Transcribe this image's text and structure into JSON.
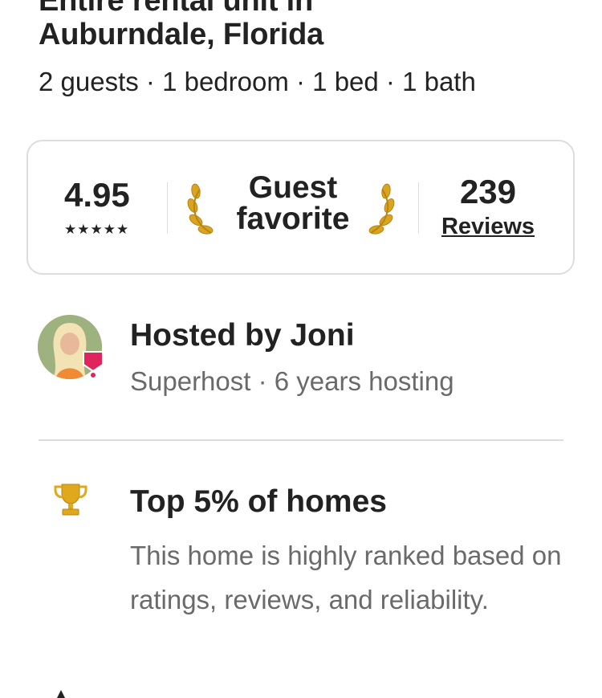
{
  "listing": {
    "title_line_1": "Entire rental unit in",
    "title_line_2": "Auburndale, Florida",
    "details": "2 guests · 1 bedroom · 1 bed · 1 bath"
  },
  "rating_card": {
    "rating": "4.95",
    "stars": "★★★★★",
    "star_count": 5,
    "badge_line_1": "Guest",
    "badge_line_2": "favorite",
    "reviews_count": "239",
    "reviews_label": "Reviews"
  },
  "host": {
    "name_text": "Hosted by Joni",
    "subtitle": "Superhost · 6 years hosting"
  },
  "highlight": {
    "icon": "trophy-icon",
    "title": "Top 5% of homes",
    "description": "This home is highly ranked based on ratings, reviews, and reliability."
  },
  "colors": {
    "text_primary": "#222222",
    "text_secondary": "#6a6a6a",
    "divider": "#dddddd",
    "superhost_badge": "#e0245e",
    "laurel_gold": "#d9a521",
    "trophy_gold": "#e0a81c"
  }
}
